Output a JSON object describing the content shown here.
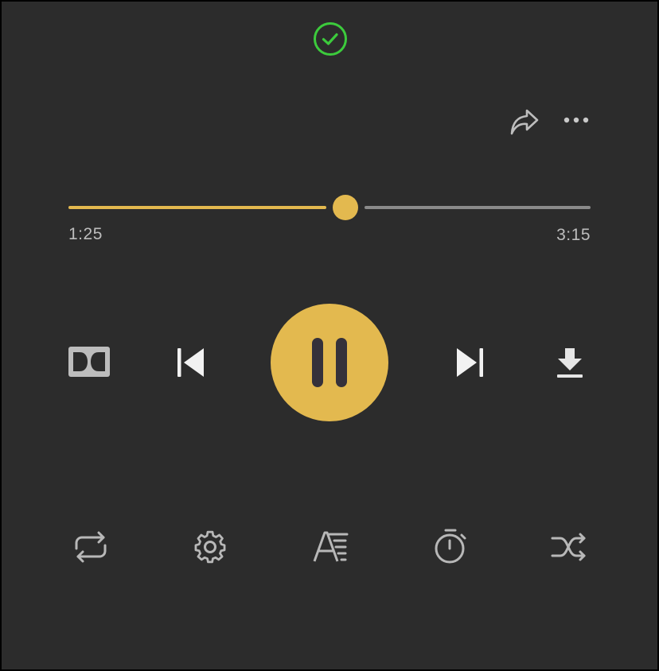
{
  "status": {
    "icon": "check-circle-icon",
    "color": "#3ccb3c"
  },
  "top_actions": [
    {
      "name": "share",
      "icon": "share-arrow-icon"
    },
    {
      "name": "more",
      "icon": "more-horizontal-icon"
    }
  ],
  "progress": {
    "elapsed": "1:25",
    "duration": "3:15",
    "fraction": 0.53,
    "played_color": "#e3b94f",
    "remaining_color": "#8a8a8a"
  },
  "controls": [
    {
      "name": "dolby",
      "icon": "dolby-icon"
    },
    {
      "name": "previous",
      "icon": "skip-previous-icon"
    },
    {
      "name": "play-pause",
      "icon": "pause-icon",
      "state": "playing"
    },
    {
      "name": "next",
      "icon": "skip-next-icon"
    },
    {
      "name": "download",
      "icon": "download-icon"
    }
  ],
  "bottom_bar": [
    {
      "name": "repeat",
      "icon": "repeat-icon"
    },
    {
      "name": "settings",
      "icon": "gear-icon"
    },
    {
      "name": "lyrics",
      "icon": "lyrics-icon"
    },
    {
      "name": "timer",
      "icon": "timer-icon"
    },
    {
      "name": "shuffle",
      "icon": "shuffle-icon"
    }
  ],
  "colors": {
    "background": "#2c2c2c",
    "accent": "#e3b94f",
    "icon": "#b8b8b8"
  }
}
